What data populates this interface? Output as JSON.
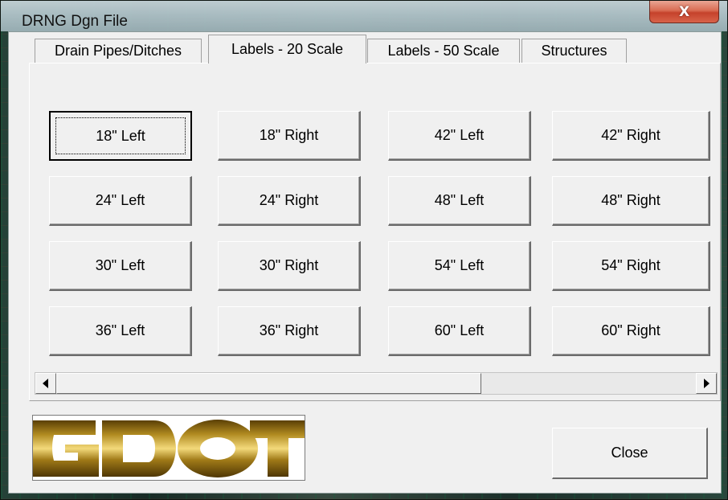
{
  "window": {
    "title": "DRNG Dgn File",
    "close_glyph": "X"
  },
  "tabs": [
    {
      "label": "Drain Pipes/Ditches",
      "active": false
    },
    {
      "label": "Labels - 20 Scale",
      "active": true
    },
    {
      "label": "Labels - 50 Scale",
      "active": false
    },
    {
      "label": "Structures",
      "active": false
    }
  ],
  "buttons": [
    [
      "18\" Left",
      "18\" Right",
      "42\" Left",
      "42\" Right"
    ],
    [
      "24\" Left",
      "24\" Right",
      "48\" Left",
      "48\" Right"
    ],
    [
      "30\" Left",
      "30\" Right",
      "54\" Left",
      "54\" Right"
    ],
    [
      "36\" Left",
      "36\" Right",
      "60\" Left",
      "60\" Right"
    ]
  ],
  "scrollbar": {
    "left_icon": "arrow-left-icon",
    "right_icon": "arrow-right-icon",
    "thumb_fraction": 0.65
  },
  "logo": {
    "text": "GDOT",
    "colors": [
      "#8a6a10",
      "#e8c65a",
      "#6b4e07"
    ]
  },
  "footer": {
    "close_label": "Close"
  }
}
